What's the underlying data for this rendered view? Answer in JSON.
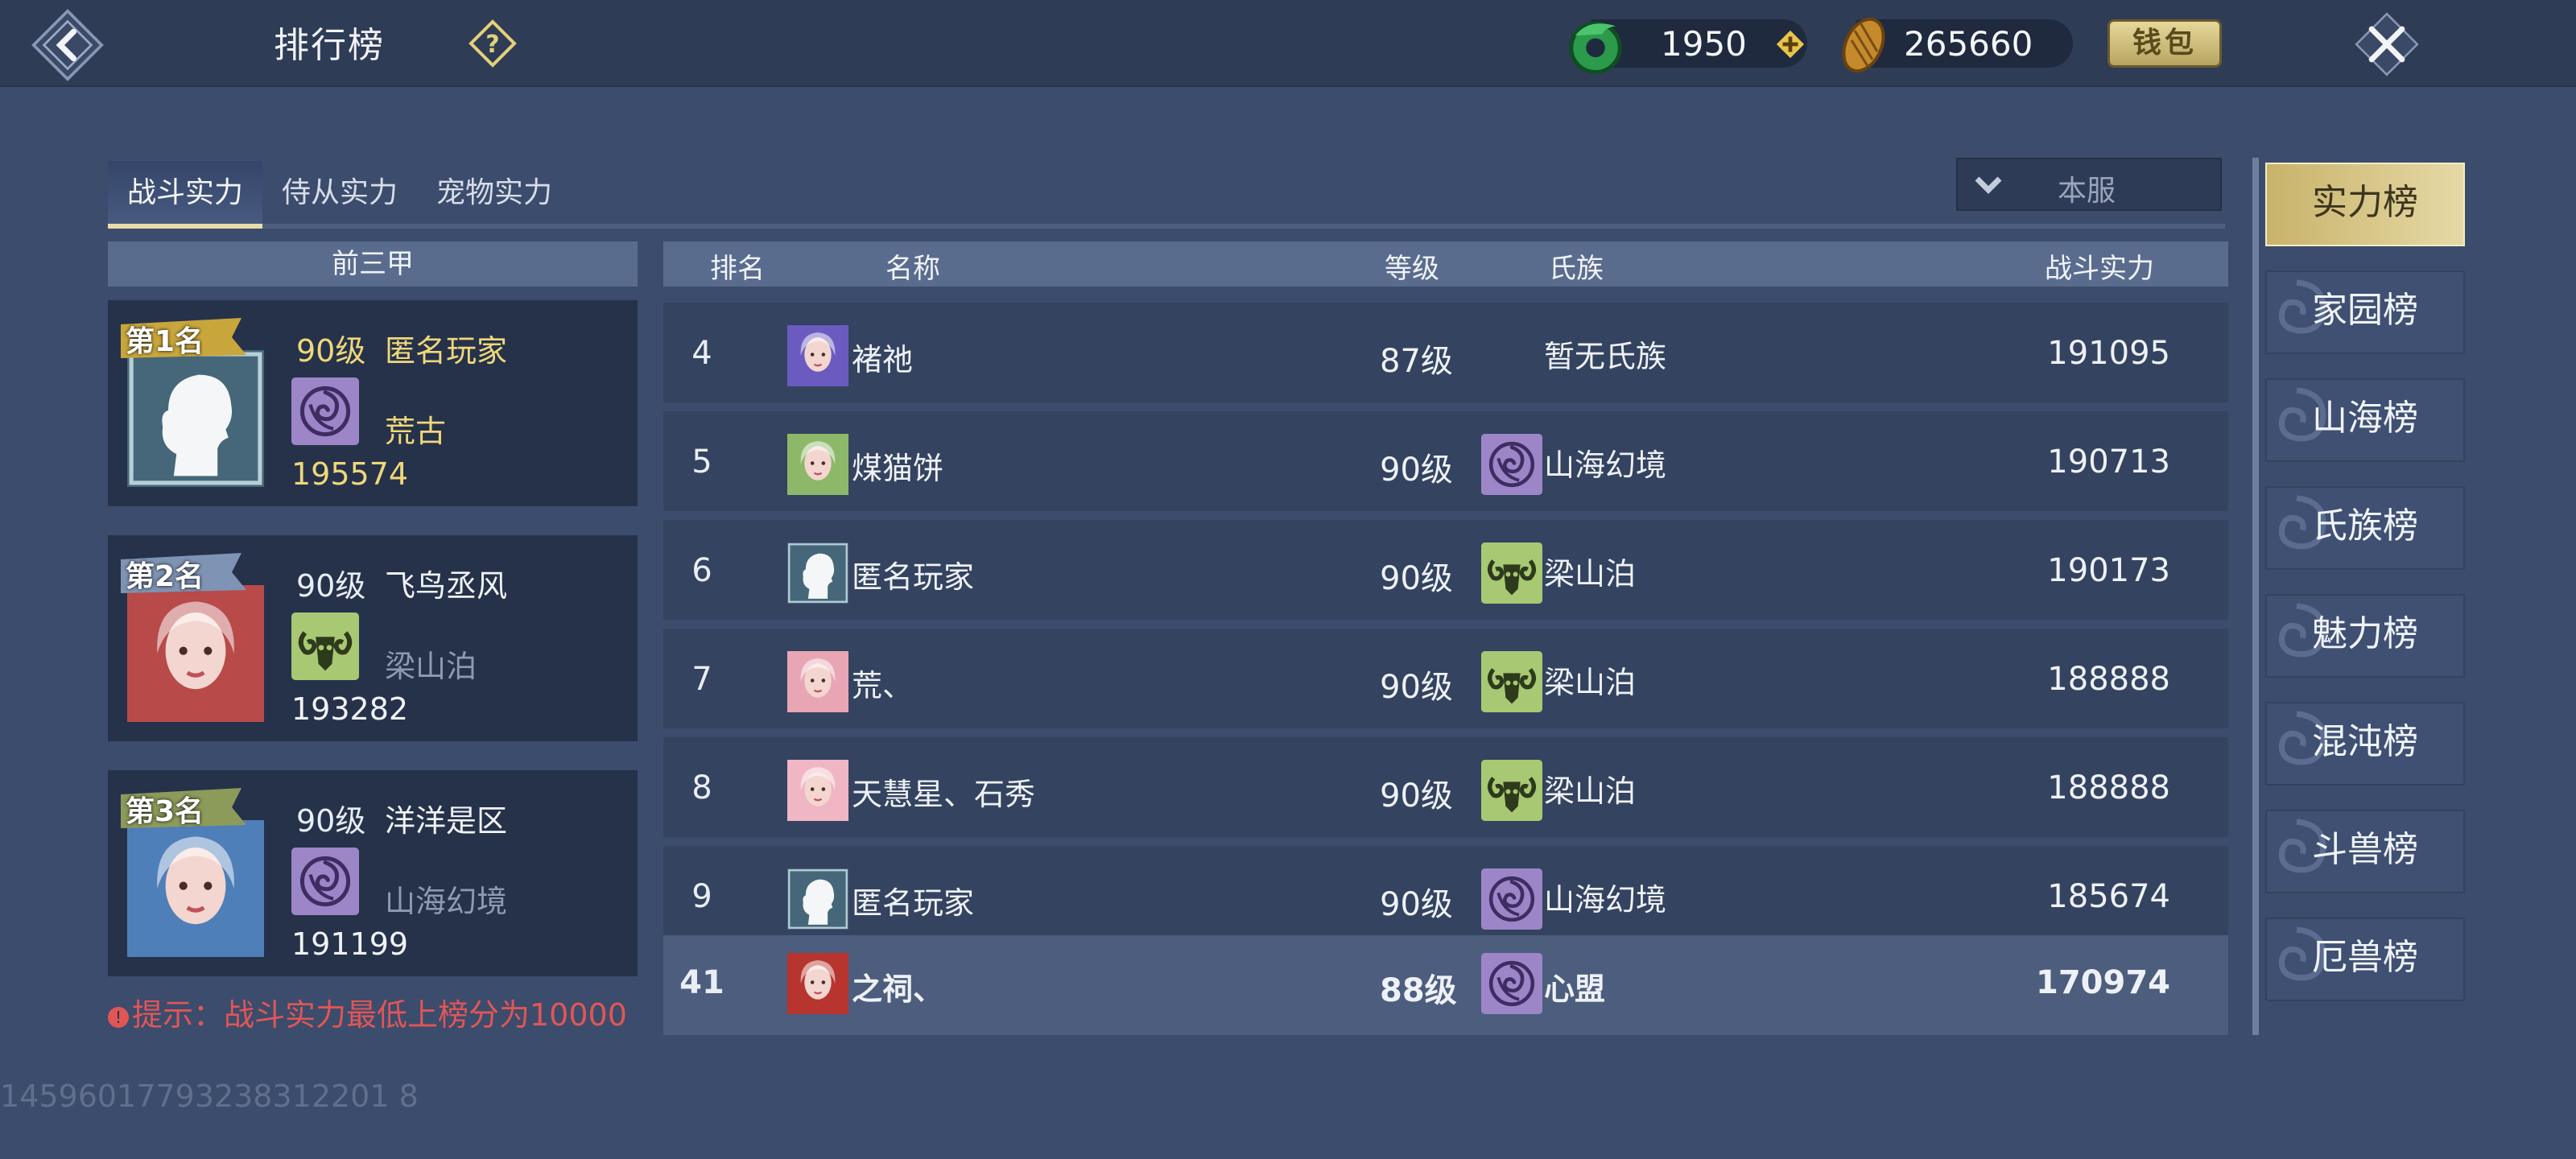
{
  "header": {
    "title": "排行榜",
    "jade_amount": "1950",
    "coin_amount": "265660",
    "wallet_label": "钱包"
  },
  "tabs": [
    {
      "label": "战斗实力",
      "active": true
    },
    {
      "label": "侍从实力",
      "active": false
    },
    {
      "label": "宠物实力",
      "active": false
    }
  ],
  "server_filter": "本服",
  "top3": {
    "header": "前三甲",
    "entries": [
      {
        "rank_label": "第1名",
        "level": "90级",
        "name": "匿名玩家",
        "clan": "荒古",
        "power": "195574",
        "avatar": "anonymous-silhouette-icon"
      },
      {
        "rank_label": "第2名",
        "level": "90级",
        "name": "飞鸟丞风",
        "clan": "梁山泊",
        "power": "193282",
        "avatar": "portrait-red-hair"
      },
      {
        "rank_label": "第3名",
        "level": "90级",
        "name": "洋洋是区",
        "clan": "山海幻境",
        "power": "191199",
        "avatar": "portrait-blue-frame"
      }
    ]
  },
  "tip": "提示：战斗实力最低上榜分为10000",
  "table": {
    "headers": {
      "rank": "排名",
      "name": "名称",
      "level": "等级",
      "clan": "氏族",
      "power": "战斗实力"
    },
    "rows": [
      {
        "rank": "4",
        "name": "褚祂",
        "level": "87级",
        "clan": "暂无氏族",
        "clan_icon": "",
        "power": "191095",
        "avatar": "portrait-purple-frame"
      },
      {
        "rank": "5",
        "name": "煤猫饼",
        "level": "90级",
        "clan": "山海幻境",
        "clan_icon": "swirl-clan-icon",
        "power": "190713",
        "avatar": "portrait-green-hair"
      },
      {
        "rank": "6",
        "name": "匿名玩家",
        "level": "90级",
        "clan": "梁山泊",
        "clan_icon": "ram-clan-icon",
        "power": "190173",
        "avatar": "anonymous-silhouette-icon"
      },
      {
        "rank": "7",
        "name": "荒、",
        "level": "90级",
        "clan": "梁山泊",
        "clan_icon": "ram-clan-icon",
        "power": "188888",
        "avatar": "portrait-pink-dark-hair"
      },
      {
        "rank": "8",
        "name": "天慧星、石秀",
        "level": "90级",
        "clan": "梁山泊",
        "clan_icon": "ram-clan-icon",
        "power": "188888",
        "avatar": "portrait-pink-white-hair"
      },
      {
        "rank": "9",
        "name": "匿名玩家",
        "level": "90级",
        "clan": "山海幻境",
        "clan_icon": "swirl-clan-icon",
        "power": "185674",
        "avatar": "anonymous-silhouette-icon"
      }
    ],
    "self_row": {
      "rank": "41",
      "name": "之祠、",
      "level": "88级",
      "clan": "心盟",
      "clan_icon": "swirl-clan-icon",
      "power": "170974",
      "avatar": "portrait-red-frame"
    }
  },
  "categories": [
    {
      "label": "实力榜",
      "active": true
    },
    {
      "label": "家园榜",
      "active": false
    },
    {
      "label": "山海榜",
      "active": false
    },
    {
      "label": "氏族榜",
      "active": false
    },
    {
      "label": "魅力榜",
      "active": false
    },
    {
      "label": "混沌榜",
      "active": false
    },
    {
      "label": "斗兽榜",
      "active": false
    },
    {
      "label": "厄兽榜",
      "active": false
    }
  ],
  "user_id": "14596017793238312201 8",
  "colors": {
    "accent_gold": "#e6d9a6",
    "tip_red": "#e05656",
    "first_place": "#f0d77a",
    "panel": "#34435f"
  }
}
